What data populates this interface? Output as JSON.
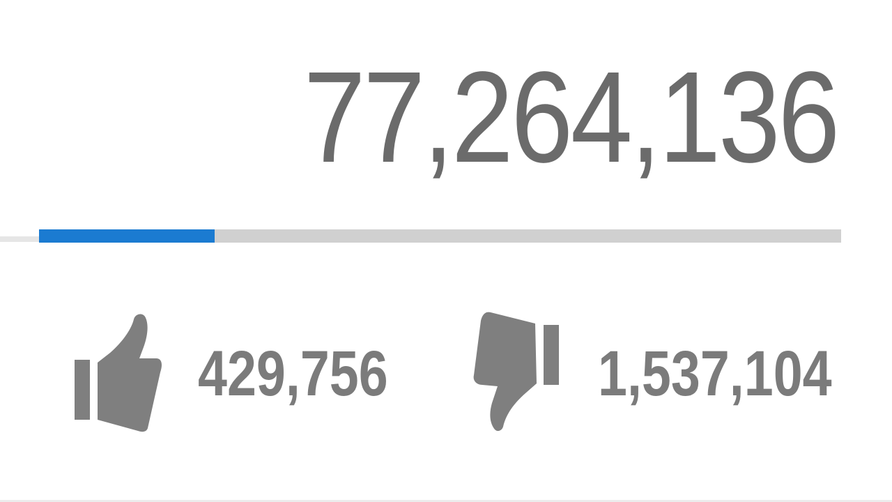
{
  "stats": {
    "views": "77,264,136",
    "likes": "429,756",
    "dislikes": "1,537,104",
    "like_ratio": 0.219
  },
  "icons": {
    "like": "thumbs-up-icon",
    "dislike": "thumbs-down-icon"
  },
  "colors": {
    "count_text": "#6b6b6b",
    "bar_fill": "#1b7bd1",
    "bar_track": "#d0d0d0"
  }
}
